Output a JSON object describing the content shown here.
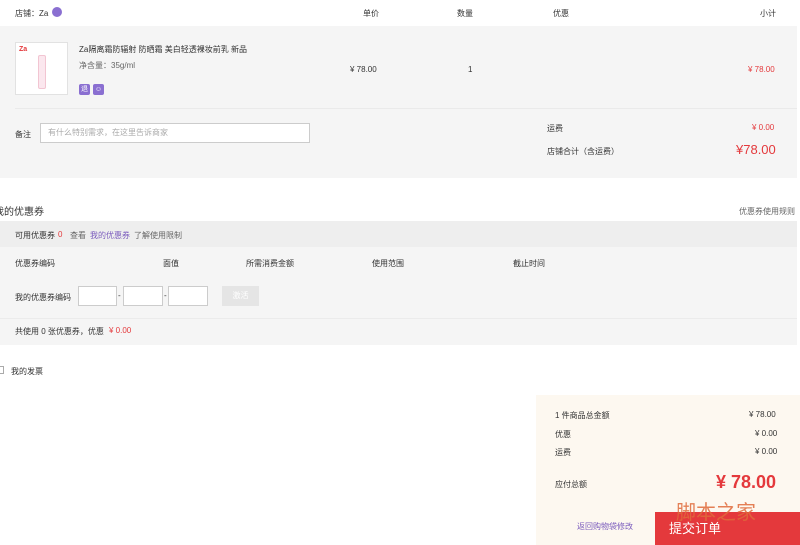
{
  "cart_header": {
    "store_label": "店铺：Za",
    "price_col": "单价",
    "qty_col": "数量",
    "discount_col": "优惠",
    "subtotal_col": "小计"
  },
  "item": {
    "thumb_brand": "Za",
    "title": "Za隔离霜防辐射 防晒霜 美白轻透裸妆前乳 新品",
    "spec": "净含量：35g/ml",
    "price": "¥ 78.00",
    "qty": "1",
    "subtotal": "¥ 78.00"
  },
  "note": {
    "label": "备注",
    "placeholder": "有什么特别需求，在这里告诉商家"
  },
  "store_totals": {
    "shipping_label": "运费",
    "shipping_value": "¥ 0.00",
    "store_total_label": "店铺合计（含运费）",
    "store_total_value": "¥78.00"
  },
  "coupons": {
    "title": "我的优惠券",
    "rules_link": "优惠券使用规则",
    "available_label": "可用优惠券",
    "available_count": "0",
    "view_text": "查看",
    "my_coupons_link": "我的优惠券",
    "limits_link": "了解使用限制",
    "columns": [
      "优惠券编码",
      "面值",
      "所需消费金额",
      "使用范围",
      "截止时间"
    ],
    "code_label": "我的优惠券编码",
    "dash1": "-",
    "dash2": "-",
    "activate_button": "激活",
    "summary_prefix": "共使用 0 张优惠券，优惠",
    "summary_value": "¥ 0.00"
  },
  "invoice": {
    "label": "我的发票"
  },
  "order_summary": {
    "goods_total_label": "1 件商品总金额",
    "goods_total_value": "¥ 78.00",
    "discount_label": "优惠",
    "discount_value": "¥ 0.00",
    "shipping_label": "运费",
    "shipping_value": "¥ 0.00",
    "payable_label": "应付总额",
    "payable_value": "¥ 78.00",
    "back_link": "返回购物袋修改",
    "submit_button": "提交订单"
  },
  "watermark": "脚本之家"
}
